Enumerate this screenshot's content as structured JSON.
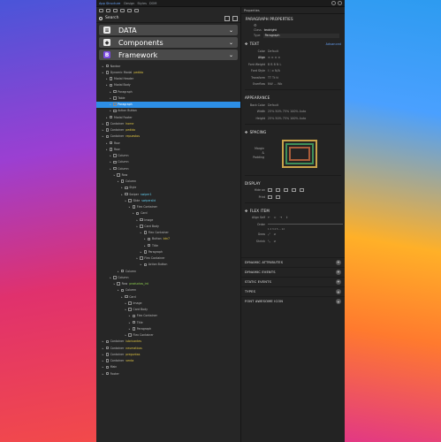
{
  "topbar": {
    "title": "App Structure",
    "menus": [
      "Design",
      "Styles",
      "DOM"
    ]
  },
  "navigator": {
    "search": {
      "label": "Search"
    },
    "sections": [
      {
        "label": "DATA",
        "icon": "database-icon"
      },
      {
        "label": "Components",
        "icon": "cube-icon"
      },
      {
        "label": "Framework",
        "icon": "bootstrap-icon"
      }
    ],
    "tree": [
      {
        "depth": 0,
        "name": "Navbar",
        "class": ""
      },
      {
        "depth": 0,
        "name": "Dynamic Modal",
        "class": "pedido"
      },
      {
        "depth": 1,
        "name": "Modal Header",
        "class": ""
      },
      {
        "depth": 1,
        "name": "Modal Body",
        "class": ""
      },
      {
        "depth": 2,
        "name": "Paragraph",
        "class": ""
      },
      {
        "depth": 2,
        "name": "Table",
        "class": ""
      },
      {
        "depth": 2,
        "name": "Paragraph",
        "class": "",
        "selected": true
      },
      {
        "depth": 2,
        "name": "Action Button",
        "class": ""
      },
      {
        "depth": 1,
        "name": "Modal Footer",
        "class": ""
      },
      {
        "depth": 0,
        "name": "Container",
        "class": "home"
      },
      {
        "depth": 0,
        "name": "Container",
        "class": "pedido"
      },
      {
        "depth": 0,
        "name": "Container",
        "class": "repuestos"
      },
      {
        "depth": 1,
        "name": "Row",
        "class": ""
      },
      {
        "depth": 1,
        "name": "Row",
        "class": ""
      },
      {
        "depth": 2,
        "name": "Column",
        "class": ""
      },
      {
        "depth": 2,
        "name": "Column",
        "class": ""
      },
      {
        "depth": 2,
        "name": "Column",
        "class": ""
      },
      {
        "depth": 3,
        "name": "Row",
        "class": ""
      },
      {
        "depth": 4,
        "name": "Column",
        "class": ""
      },
      {
        "depth": 5,
        "name": "Style",
        "class": ""
      },
      {
        "depth": 5,
        "name": "Swiper",
        "class": "swiper1"
      },
      {
        "depth": 6,
        "name": "Slide",
        "class": "swiperslid"
      },
      {
        "depth": 7,
        "name": "Flex Container",
        "class": ""
      },
      {
        "depth": 8,
        "name": "Card",
        "class": ""
      },
      {
        "depth": 9,
        "name": "Image",
        "class": ""
      },
      {
        "depth": 9,
        "name": "Card Body",
        "class": ""
      },
      {
        "depth": 10,
        "name": "Flex Container",
        "class": ""
      },
      {
        "depth": 11,
        "name": "Button",
        "class": "btn7"
      },
      {
        "depth": 11,
        "name": "Title",
        "class": ""
      },
      {
        "depth": 10,
        "name": "Paragraph",
        "class": ""
      },
      {
        "depth": 9,
        "name": "Flex Container",
        "class": ""
      },
      {
        "depth": 10,
        "name": "Action Button",
        "class": ""
      },
      {
        "depth": 4,
        "name": "Column",
        "class": ""
      },
      {
        "depth": 2,
        "name": "Column",
        "class": ""
      },
      {
        "depth": 3,
        "name": "Row",
        "class": "productos_int"
      },
      {
        "depth": 4,
        "name": "Column",
        "class": ""
      },
      {
        "depth": 5,
        "name": "Card",
        "class": ""
      },
      {
        "depth": 6,
        "name": "Image",
        "class": ""
      },
      {
        "depth": 6,
        "name": "Card Body",
        "class": ""
      },
      {
        "depth": 7,
        "name": "Flex Container",
        "class": ""
      },
      {
        "depth": 7,
        "name": "Title",
        "class": ""
      },
      {
        "depth": 7,
        "name": "Paragraph",
        "class": ""
      },
      {
        "depth": 6,
        "name": "Flex Container",
        "class": ""
      },
      {
        "depth": 0,
        "name": "Container",
        "class": "lubricantes"
      },
      {
        "depth": 0,
        "name": "Container",
        "class": "neumaticos"
      },
      {
        "depth": 0,
        "name": "Container",
        "class": "preguntas"
      },
      {
        "depth": 0,
        "name": "Container",
        "class": "venta"
      },
      {
        "depth": 0,
        "name": "Main",
        "class": ""
      },
      {
        "depth": 0,
        "name": "Footer",
        "class": ""
      }
    ]
  },
  "properties": {
    "header": "Properties",
    "paragraph_title": "PARAGRAPH PROPERTIES",
    "class_label": "Class",
    "class_value": "textright",
    "type_label": "Type",
    "type_value": "Paragraph",
    "text_title": "TEXT",
    "advanced": "Advanced",
    "text_rows": [
      {
        "k": "Color",
        "v": "Default"
      },
      {
        "k": "Align",
        "v": "≡  ≡  ≡  ≡"
      },
      {
        "k": "Font Weight",
        "v": "B  B  B  N  L"
      },
      {
        "k": "Font Style",
        "v": "I  ⧸  ≡  N/A"
      },
      {
        "k": "Transform",
        "v": "TT  Tt  tt"
      },
      {
        "k": "Overflow",
        "v": "NW  ...  Wb"
      }
    ],
    "appearance_title": "APPEARANCE",
    "appearance_rows": [
      {
        "k": "Back Color",
        "v": "Default"
      },
      {
        "k": "Width",
        "v": "25%  50%  75%  100%  Auto"
      },
      {
        "k": "Height",
        "v": "25%  50%  75%  100%  Auto"
      }
    ],
    "spacing_title": "SPACING",
    "spacing_labels": {
      "margin": "Margin",
      "and": "&",
      "padding": "Padding"
    },
    "display_title": "DISPLAY",
    "display_rows": [
      {
        "k": "Hide on"
      },
      {
        "k": "Print"
      }
    ],
    "flex_title": "FLEX ITEM",
    "flex_rows": [
      {
        "k": "Align Self"
      },
      {
        "k": "Order",
        "v": "1  2  3  4  5  ...  12"
      },
      {
        "k": "Grow"
      },
      {
        "k": "Shrink"
      }
    ],
    "collapsed": [
      "DYNAMIC ATTRIBUTES",
      "DYNAMIC EVENTS",
      "STATIC EVENTS",
      "TYPES",
      "FONT AWESOME ICON"
    ],
    "colors": {
      "selected": "#2d8fe6",
      "accent": "#6aa7ff",
      "spacing_outer": "#c9a24a",
      "spacing_mid": "#3f8f5a",
      "spacing_inner": "#a95c3a"
    }
  }
}
